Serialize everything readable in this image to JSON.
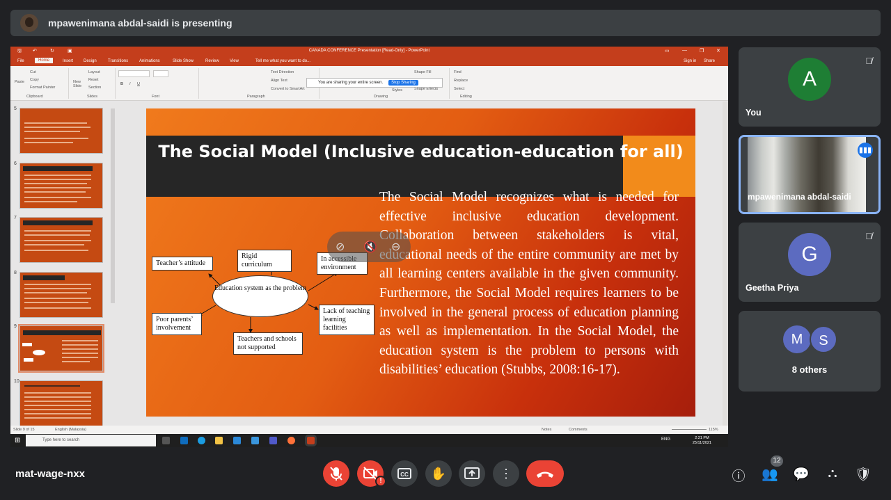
{
  "banner": {
    "text": "mpawenimana abdal-saidi is presenting"
  },
  "ppt": {
    "window_title": "CANADA CONFERENCE Presentation [Read-Only] - PowerPoint",
    "tell_me": "Tell me what you want to do...",
    "signin": "Sign in",
    "share": "Share",
    "menu": [
      "File",
      "Home",
      "Insert",
      "Design",
      "Transitions",
      "Animations",
      "Slide Show",
      "Review",
      "View"
    ],
    "ribbon_groups": [
      "Clipboard",
      "Slides",
      "Font",
      "Paragraph",
      "Drawing",
      "Editing"
    ],
    "ribbon_labels": {
      "paste": "Paste",
      "cut": "Cut",
      "copy": "Copy",
      "format_painter": "Format Painter",
      "new_slide": "New Slide",
      "layout": "Layout",
      "reset": "Reset",
      "section": "Section",
      "text_direction": "Text Direction",
      "align_text": "Align Text",
      "convert_smartart": "Convert to SmartArt",
      "shape_fill": "Shape Fill",
      "shape_effects": "Shape Effects",
      "styles": "Styles",
      "find": "Find",
      "replace": "Replace",
      "select": "Select"
    },
    "sharing_bar": {
      "label": "You are sharing your entire screen.",
      "stop": "Stop Sharing"
    },
    "thumbnails": [
      {
        "num": "5"
      },
      {
        "num": "6"
      },
      {
        "num": "7"
      },
      {
        "num": "8"
      },
      {
        "num": "9"
      },
      {
        "num": "10"
      }
    ],
    "slide": {
      "title": "The Social Model (Inclusive education-education for all)",
      "body": "The Social Model recognizes what is needed for effective inclusive education development. Collaboration between stakeholders is vital, educational needs of the entire community are met by all learning centers available in the given community. Furthermore, the Social Model requires learners to be involved in the general process of education planning as well as implementation. In the Social Model, the education system is the problem to persons with disabilities’ education (Stubbs, 2008:16-17).",
      "diagram": {
        "center": "Education system as the problem",
        "boxes": [
          "Teacher’s attitude",
          "Rigid curriculum",
          "In accessible environment",
          "Lack of teaching learning facilities",
          "Teachers and schools not supported",
          "Poor parents’ involvement"
        ]
      }
    },
    "status": {
      "slide_of": "Slide 9 of 15",
      "language": "English (Malaysia)",
      "notes": "Notes",
      "comments": "Comments",
      "zoom": "115%"
    },
    "taskbar": {
      "search_placeholder": "Type here to search",
      "lang": "ENG",
      "time": "2:21 PM",
      "date": "25/11/2021"
    }
  },
  "participants": [
    {
      "name": "You",
      "initial": "A",
      "color": "#1e7e34",
      "muted": true
    },
    {
      "name": "mpawenimana abdal-saidi",
      "speaking": true
    },
    {
      "name": "Geetha Priya",
      "initial": "G",
      "color": "#5c6bc0",
      "muted": true
    },
    {
      "name": "8 others",
      "initials": [
        "M",
        "S"
      ],
      "color": "#5c6bc0"
    }
  ],
  "meeting": {
    "code": "mat-wage-nxx",
    "participant_count": "12",
    "colors": {
      "danger": "#ea4335",
      "tile": "#3c4043",
      "background": "#202124",
      "active_border": "#8ab4f8"
    }
  }
}
